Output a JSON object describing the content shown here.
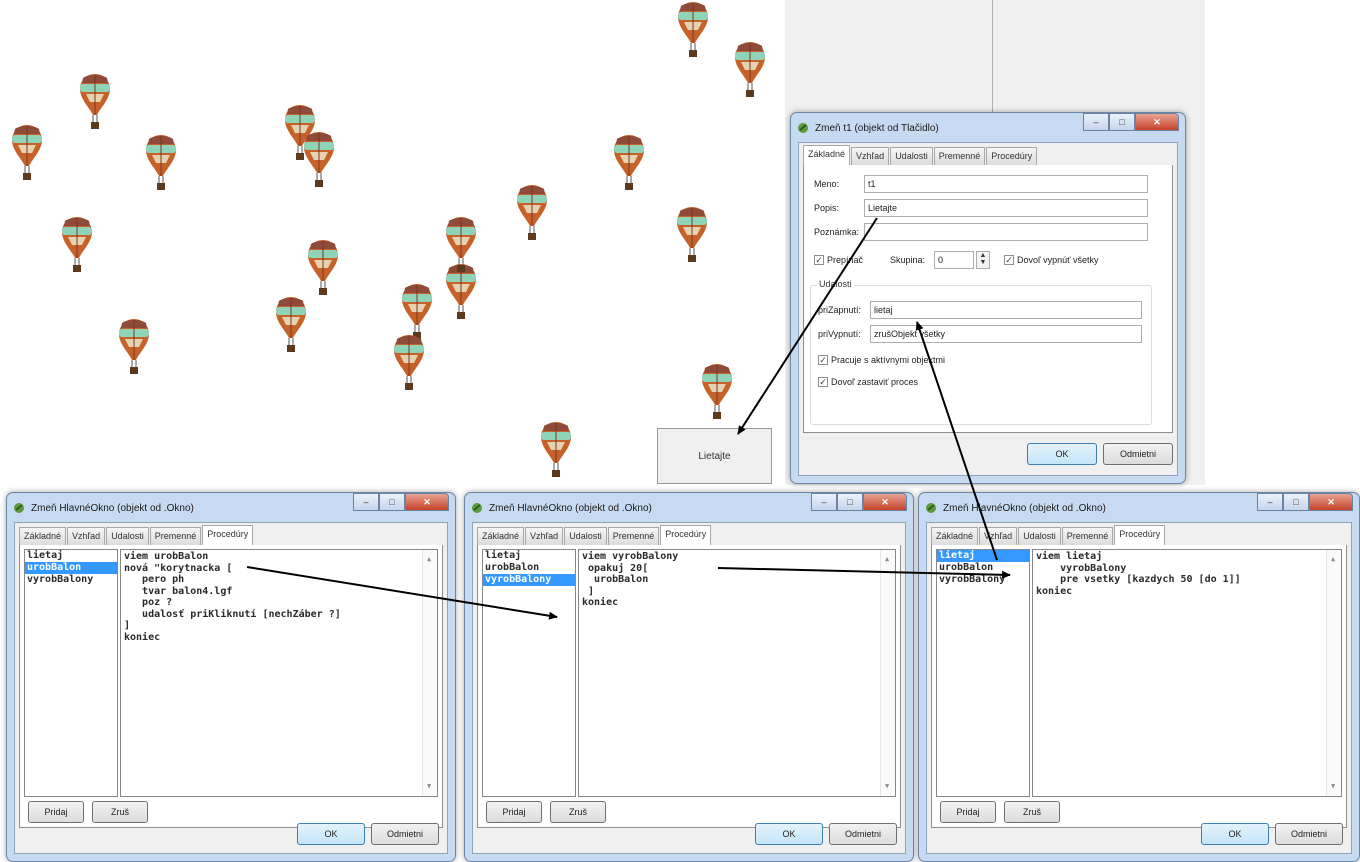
{
  "canvas": {
    "button_label": "Lietajte"
  },
  "dialog_t1": {
    "title": "Zmeň t1 (objekt od Tlačidlo)",
    "tabs": [
      "Základné",
      "Vzhľad",
      "Udalosti",
      "Premenné",
      "Procedúry"
    ],
    "fields": {
      "meno_label": "Meno:",
      "meno_value": "t1",
      "popis_label": "Popis:",
      "popis_value": "Lietajte",
      "poznamka_label": "Poznámka:",
      "poznamka_value": ""
    },
    "prepinac_label": "Prepínač",
    "skupina_label": "Skupina:",
    "skupina_value": "0",
    "dovol_vypnut_label": "Dovoľ vypnúť všetky",
    "udalosti_label": "Udalosti",
    "pri_zapnuti_label": "priZapnutí:",
    "pri_zapnuti_value": "lietaj",
    "pri_vypnuti_label": "priVypnutí:",
    "pri_vypnuti_value": "zrušObjekt všetky",
    "pracuje_label": "Pracuje s aktívnymi objektmi",
    "dovol_zastavit_label": "Dovoľ zastaviť proces",
    "ok_label": "OK",
    "cancel_label": "Odmietni"
  },
  "dialogs": [
    {
      "title": "Zmeň HlavnéOkno (objekt od .Okno)",
      "tabs": [
        "Základné",
        "Vzhľad",
        "Udalosti",
        "Premenné",
        "Procedúry"
      ],
      "procedures": [
        "lietaj",
        "urobBalon",
        "vyrobBalony"
      ],
      "selected": 1,
      "code": "viem urobBalon\nnová \"korytnacka [\n   pero ph\n   tvar balon4.lgf\n   poz ?\n   udalosť priKliknutí [nechZáber ?]\n]\nkoniec",
      "add_label": "Pridaj",
      "delete_label": "Zruš",
      "ok_label": "OK",
      "cancel_label": "Odmietni"
    },
    {
      "title": "Zmeň HlavnéOkno (objekt od .Okno)",
      "tabs": [
        "Základné",
        "Vzhľad",
        "Udalosti",
        "Premenné",
        "Procedúry"
      ],
      "procedures": [
        "lietaj",
        "urobBalon",
        "vyrobBalony"
      ],
      "selected": 2,
      "code": "viem vyrobBalony\n opakuj 20[\n  urobBalon\n ]\nkoniec",
      "add_label": "Pridaj",
      "delete_label": "Zruš",
      "ok_label": "OK",
      "cancel_label": "Odmietni"
    },
    {
      "title": "Zmeň HlavnéOkno (objekt od .Okno)",
      "tabs": [
        "Základné",
        "Vzhľad",
        "Udalosti",
        "Premenné",
        "Procedúry"
      ],
      "procedures": [
        "lietaj",
        "urobBalon",
        "vyrobBalony"
      ],
      "selected": 0,
      "code": "viem lietaj\n    vyrobBalony\n    pre vsetky [kazdych 50 [do 1]]\nkoniec",
      "add_label": "Pridaj",
      "delete_label": "Zruš",
      "ok_label": "OK",
      "cancel_label": "Odmietni"
    }
  ],
  "colors": {
    "balloon_top": "#8f4a38",
    "balloon_band": "#8fd3b8",
    "balloon_body": "#c6612a",
    "window_frame": "#c6daf1",
    "selection": "#3399ff"
  }
}
